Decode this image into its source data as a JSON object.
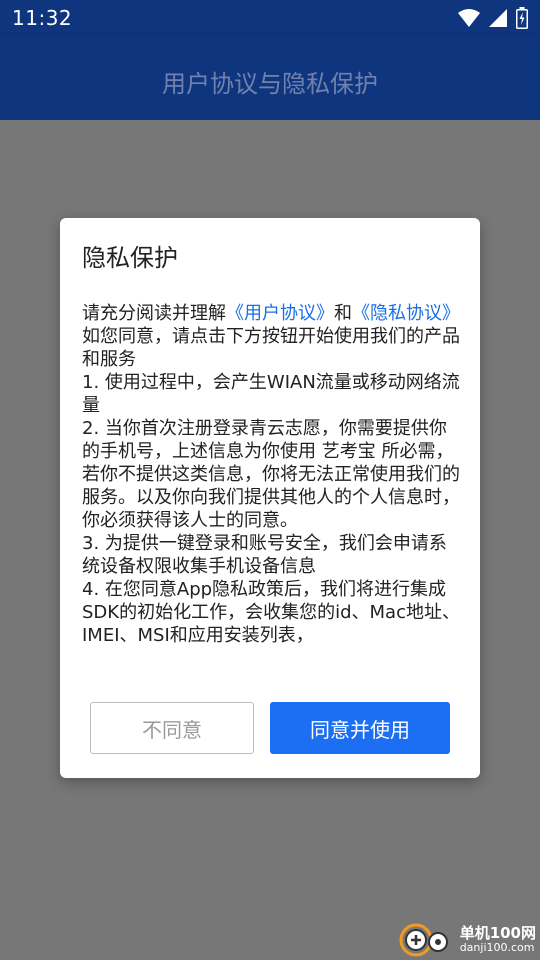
{
  "status_bar": {
    "time": "11:32",
    "icons": [
      "wifi-icon",
      "signal-icon",
      "battery-icon"
    ]
  },
  "app_bar": {
    "title": "用户协议与隐私保护"
  },
  "dialog": {
    "title": "隐私保护",
    "intro_prefix": "请充分阅读并理解",
    "link_user_agreement": "《用户协议》",
    "intro_and": "和",
    "link_privacy_agreement": "《隐私协议》",
    "intro_suffix": "如您同意，请点击下方按钮开始使用我们的产品和服务",
    "items": [
      "1. 使用过程中，会产生WIAN流量或移动网络流量",
      "2. 当你首次注册登录青云志愿，你需要提供你的手机号，上述信息为你使用 艺考宝 所必需，若你不提供这类信息，你将无法正常使用我们的服务。以及你向我们提供其他人的个人信息时，你必须获得该人士的同意。",
      "3. 为提供一键登录和账号安全，我们会申请系统设备权限收集手机设备信息",
      "4. 在您同意App隐私政策后，我们将进行集成SDK的初始化工作，会收集您的id、Mac地址、IMEI、MSI和应用安装列表，"
    ],
    "disagree_label": "不同意",
    "agree_label": "同意并使用"
  },
  "watermark": {
    "name": "单机100网",
    "url": "danji100.com"
  },
  "colors": {
    "app_bar": "#10357f",
    "overlay": "#777777",
    "link": "#1a6fe8",
    "agree_button": "#1c6ef2"
  }
}
